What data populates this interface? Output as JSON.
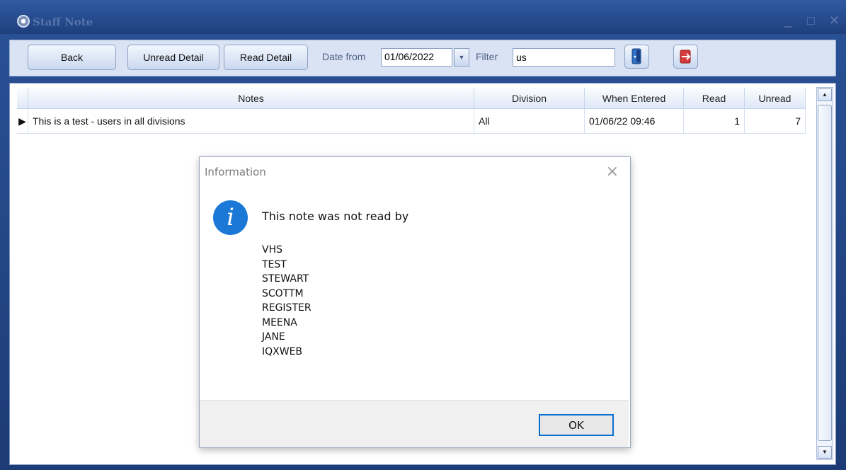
{
  "window": {
    "title": "Staff Note",
    "minimize": "_",
    "maximize": "□",
    "close": "✕"
  },
  "toolbar": {
    "back": "Back",
    "unread_detail": "Unread Detail",
    "read_detail": "Read Detail",
    "date_from_label": "Date from",
    "date_from_value": "01/06/2022",
    "filter_label": "Filter",
    "filter_value": "us",
    "icon1": "door-exit-icon",
    "icon2": "logout-icon"
  },
  "grid": {
    "headers": [
      "Notes",
      "Division",
      "When Entered",
      "Read",
      "Unread"
    ],
    "rows": [
      {
        "notes": "This is a test - users in all divisions",
        "division": "All",
        "when_entered": "01/06/22 09:46",
        "read": "1",
        "unread": "7"
      }
    ]
  },
  "dialog": {
    "title": "Information",
    "message": "This note was not read by",
    "names": [
      "VHS",
      "TEST",
      "STEWART",
      "SCOTTM",
      "REGISTER",
      "MEENA",
      "JANE",
      "IQXWEB"
    ],
    "ok": "OK",
    "close": "×",
    "info_glyph": "i"
  }
}
